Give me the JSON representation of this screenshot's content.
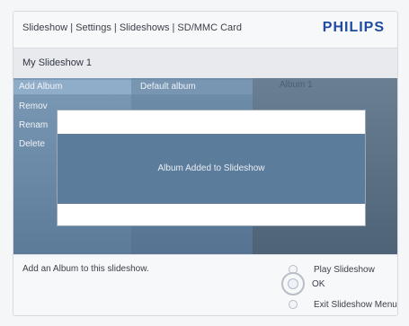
{
  "header": {
    "breadcrumb": "Slideshow | Settings | Slideshows | SD/MMC Card",
    "brand": "PHILIPS"
  },
  "subheader": {
    "title": "My Slideshow 1"
  },
  "menu": {
    "items": [
      {
        "label": "Add Album",
        "active": true
      },
      {
        "label": "Remov"
      },
      {
        "label": "Renam"
      },
      {
        "label": "Delete"
      }
    ],
    "albums": {
      "default": "Default album",
      "other": "Album 1"
    }
  },
  "dialog": {
    "message": "Album Added to Slideshow"
  },
  "footer": {
    "hint": "Add an Album to this slideshow.",
    "options": [
      {
        "label": "Play Slideshow"
      },
      {
        "label": "OK"
      },
      {
        "label": "Exit Slideshow Menu"
      }
    ]
  }
}
